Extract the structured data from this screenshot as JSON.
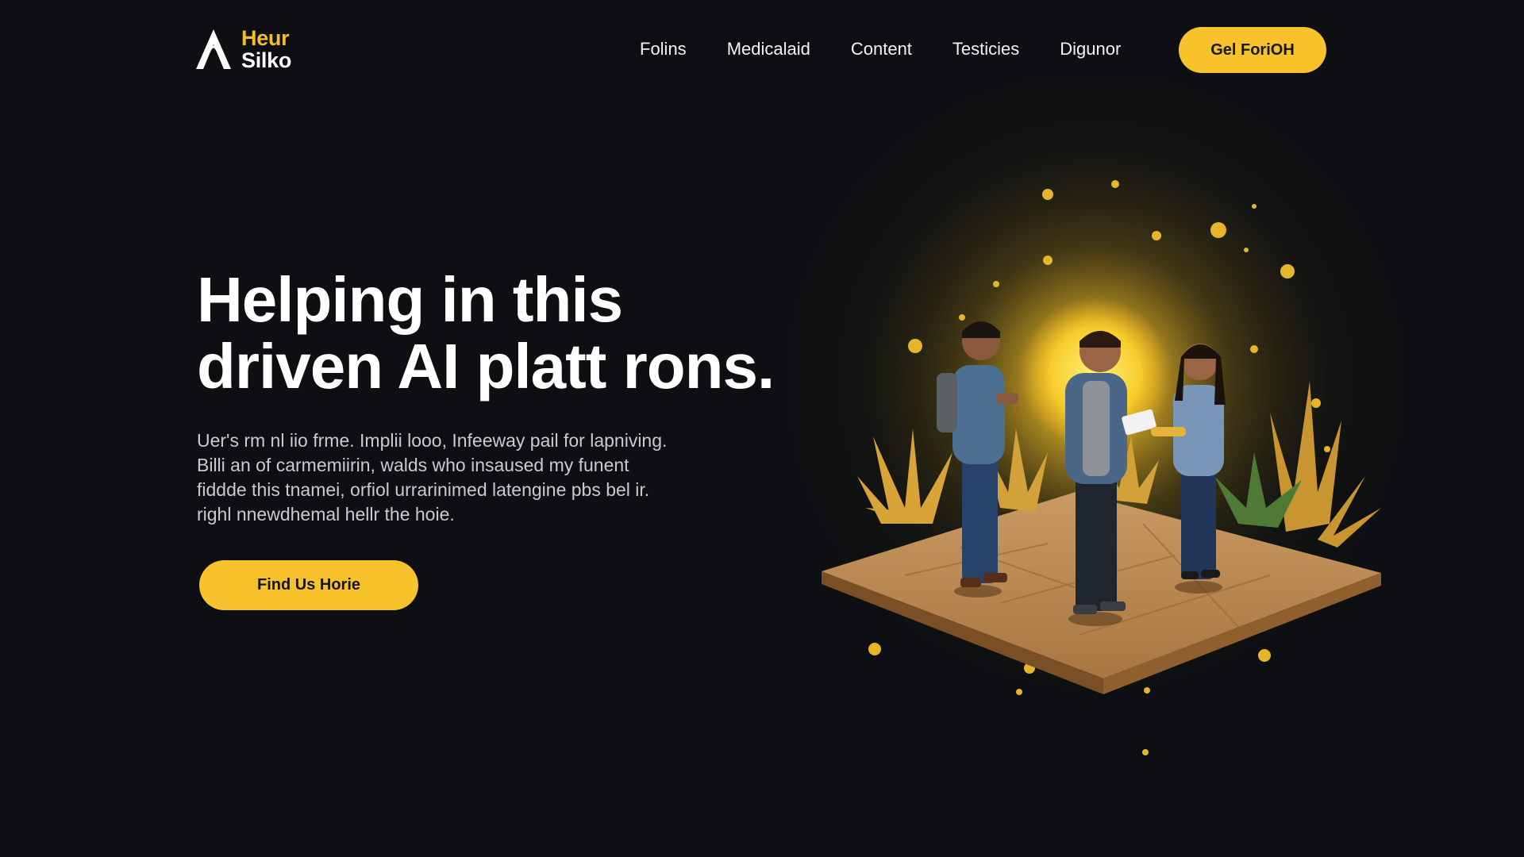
{
  "brand": {
    "line1": "Heur",
    "line2": "Silko",
    "accent_color": "#f7c22b",
    "background_color": "#0d0f12",
    "logo_icon": "stylized-a-logo-icon"
  },
  "nav": {
    "items": [
      {
        "label": "Folins"
      },
      {
        "label": "Medicalaid"
      },
      {
        "label": "Content"
      },
      {
        "label": "Testicies"
      },
      {
        "label": "Digunor"
      }
    ],
    "cta_label": "Gel ForiOH"
  },
  "hero": {
    "title_line1": "Helping in this",
    "title_line2": "driven AI platt rons.",
    "description_lines": [
      "Uer's rm nl iio frme. Implii looo, Infeeway pail for lapniving.",
      "Billi an of carmemiirin, walds who insaused my funent",
      "fiddde this tnamei, orfiol urrarinimed latengine pbs bel ir.",
      "righl nnewdhemal hellr the hoie."
    ],
    "button_label": "Find Us Horie"
  },
  "illustration": {
    "subject": "three people talking on a floating stone tile with golden plants and a glowing sun"
  }
}
